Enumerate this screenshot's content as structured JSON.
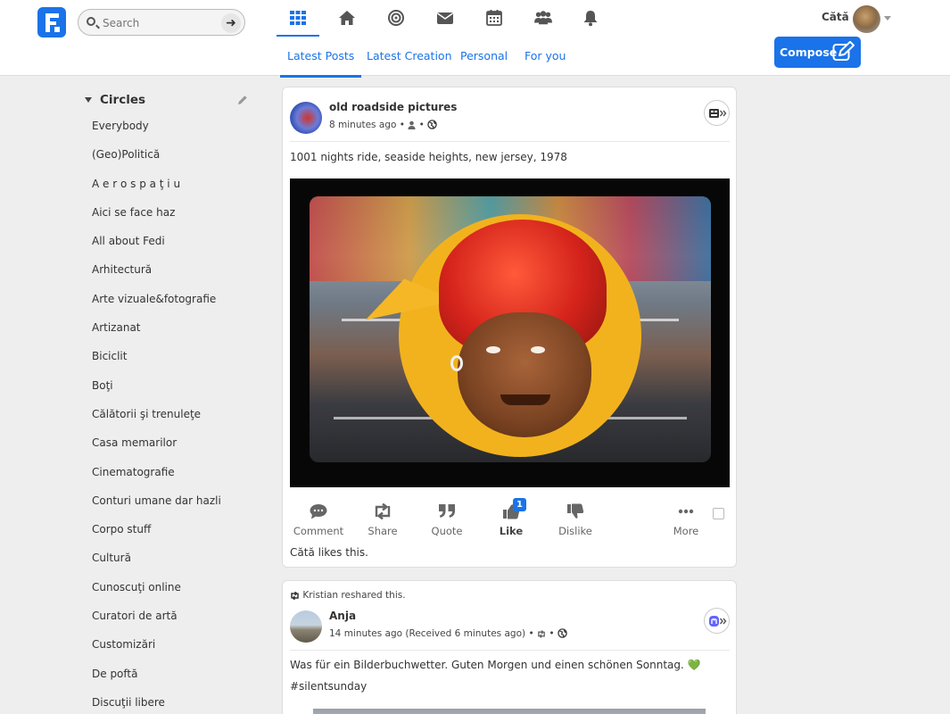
{
  "colors": {
    "accent": "#1a73e8",
    "background": "#eeeeee",
    "card": "#ffffff",
    "heart": "#5cb85c"
  },
  "search": {
    "placeholder": "Search"
  },
  "nav_icons": [
    "network-grid-icon",
    "home-icon",
    "target-icon",
    "envelope-icon",
    "calendar-icon",
    "users-icon",
    "bell-icon"
  ],
  "tabs": [
    {
      "label": "Latest Posts",
      "active": true
    },
    {
      "label": "Latest Creation",
      "active": false
    },
    {
      "label": "Personal",
      "active": false
    },
    {
      "label": "For you",
      "active": false
    }
  ],
  "user": {
    "name": "Cătă"
  },
  "compose": {
    "label": "Compose"
  },
  "sidebar": {
    "title": "Circles",
    "items": [
      "Everybody",
      "(Geo)Politică",
      "A e r o s p a ţ i u",
      "Aici se face haz",
      "All about Fedi",
      "Arhitectură",
      "Arte vizuale&fotografie",
      "Artizanat",
      "Biciclit",
      "Boţi",
      "Călătorii şi trenuleţe",
      "Casa memarilor",
      "Cinematografie",
      "Conturi umane dar hazli",
      "Corpo stuff",
      "Cultură",
      "Cunoscuţi online",
      "Curatori de artă",
      "Customizări",
      "De poftă",
      "Discuţii libere"
    ]
  },
  "posts": [
    {
      "author": "old roadside pictures",
      "time": "8 minutes ago",
      "meta_separator": "•",
      "network_icon": "feed-network-icon",
      "text": "1001 nights ride, seaside heights, new jersey, 1978",
      "actions": {
        "comment": "Comment",
        "share": "Share",
        "quote": "Quote",
        "like": "Like",
        "dislike": "Dislike",
        "more": "More"
      },
      "like_count": "1",
      "likes_line": "Cătă likes this."
    },
    {
      "reshared_by": "Kristian",
      "reshare_suffix": "reshared this.",
      "author": "Anja",
      "time": "14 minutes ago (Received 6 minutes ago)",
      "meta_separator": "•",
      "network_icon": "mastodon-icon",
      "text": "Was für ein Bilderbuchwetter. Guten Morgen und einen schönen Sonntag.",
      "emoji": "💚",
      "hashtag": "#silentsunday"
    }
  ]
}
